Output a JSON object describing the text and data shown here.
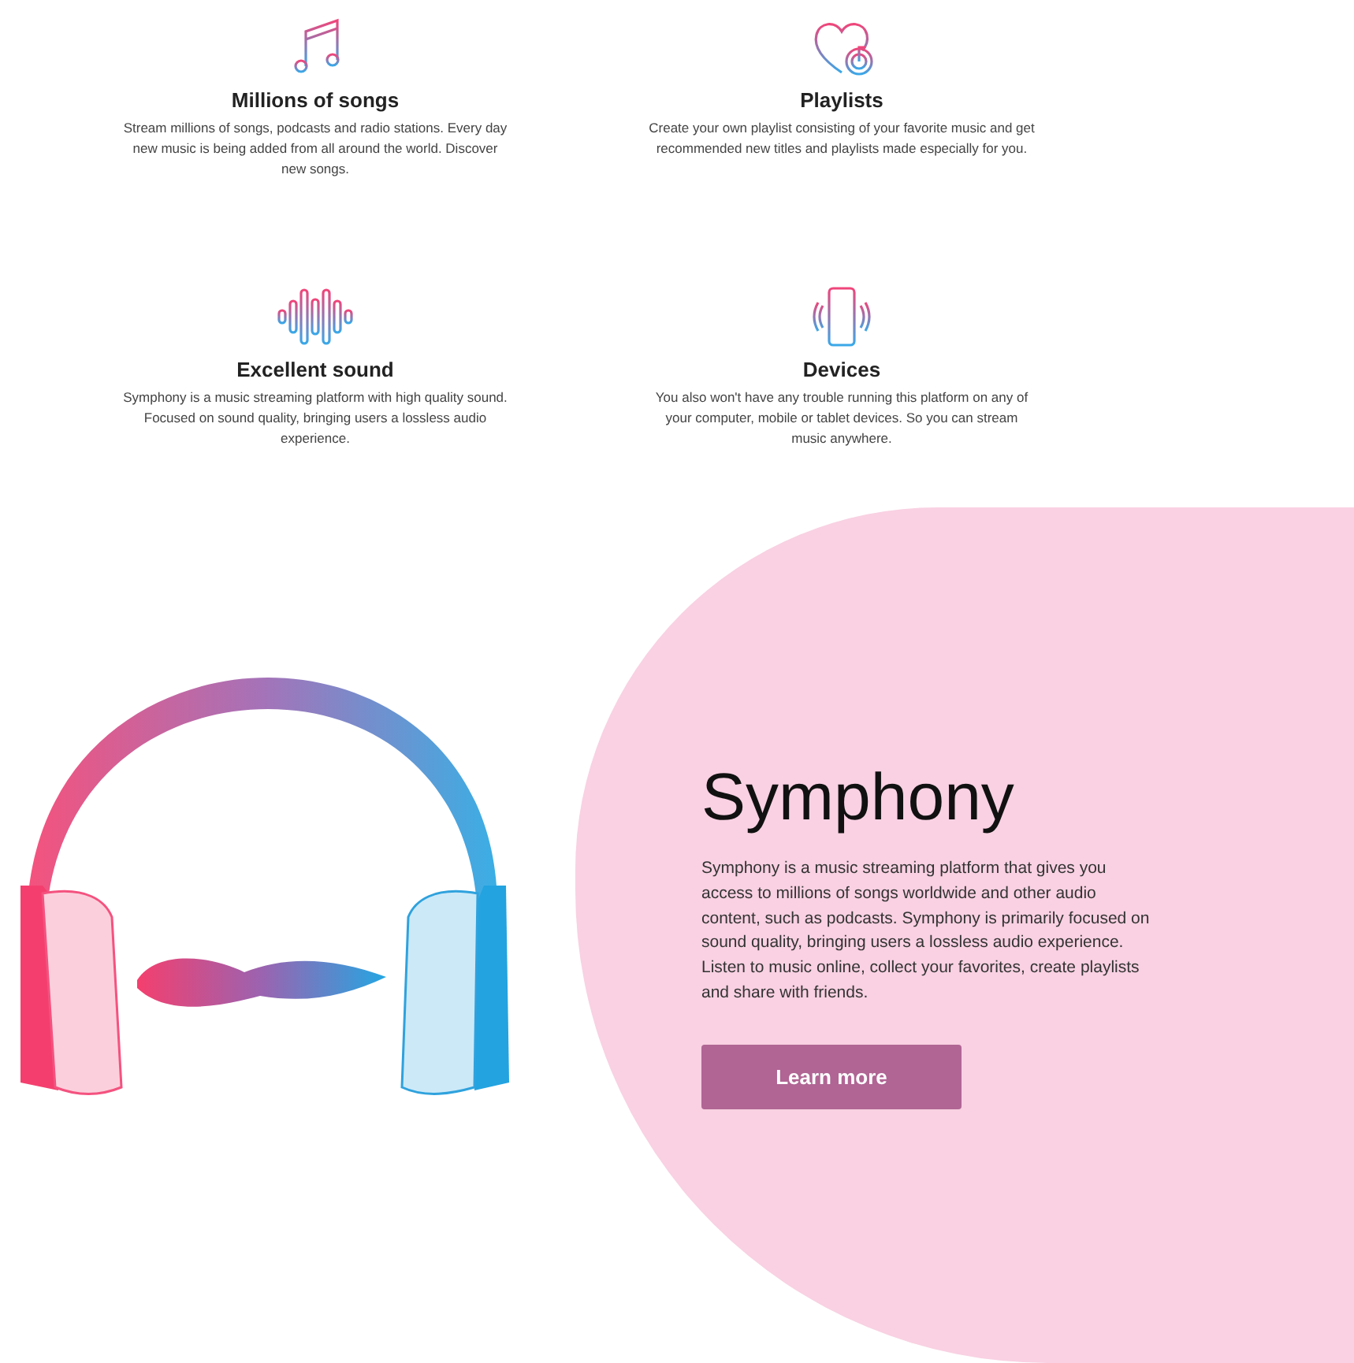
{
  "features": [
    {
      "title": "Millions of songs",
      "text": "Stream millions of songs, podcasts and radio stations. Every day new music is being added from all around the world. Discover new songs."
    },
    {
      "title": "Playlists",
      "text": "Create your own playlist consisting of your favorite music and get recommended new titles and playlists made especially for you."
    },
    {
      "title": "Excellent sound",
      "text": "Symphony is a music streaming platform with high quality sound. Focused on sound quality, bringing users a lossless audio experience."
    },
    {
      "title": "Devices",
      "text": "You also won't have any trouble running this platform on any of your computer, mobile or tablet devices. So you can stream music anywhere."
    }
  ],
  "hero": {
    "title": "Symphony",
    "text": "Symphony is a music streaming platform that gives you access to millions of songs worldwide and other audio content, such as podcasts. Symphony is primarily focused on sound quality, bringing users a lossless audio experience. Listen to music online, collect your favorites, create playlists and share with friends.",
    "button": "Learn more"
  }
}
